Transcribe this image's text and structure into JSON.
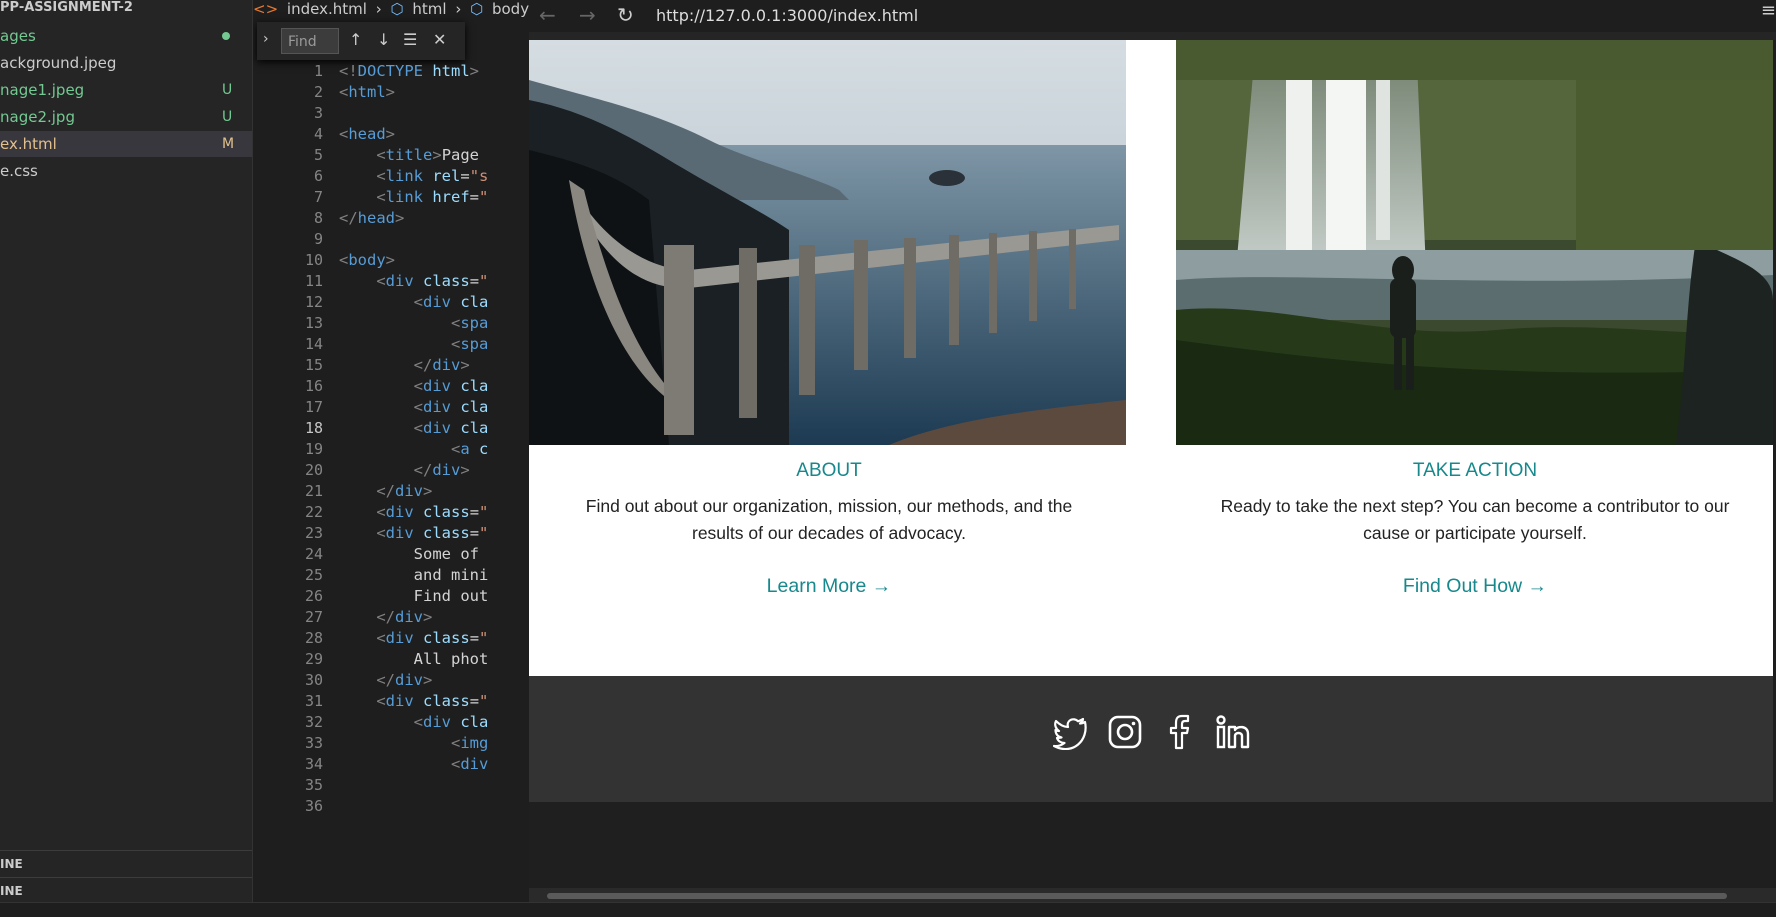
{
  "explorer": {
    "title": "PP-ASSIGNMENT-2",
    "items": [
      {
        "label": "ages",
        "badge": "",
        "status": "dot"
      },
      {
        "label": "ackground.jpeg",
        "badge": "",
        "status": "none"
      },
      {
        "label": "nage1.jpeg",
        "badge": "U",
        "status": "untracked"
      },
      {
        "label": "nage2.jpg",
        "badge": "U",
        "status": "untracked"
      },
      {
        "label": "ex.html",
        "badge": "M",
        "status": "modified"
      },
      {
        "label": "e.css",
        "badge": "",
        "status": "none"
      }
    ],
    "sections": [
      "INE",
      "INE"
    ]
  },
  "editor": {
    "breadcrumb": [
      "index.html",
      "html",
      "body"
    ],
    "find_placeholder": "Find",
    "current_line": 18,
    "line_numbers": [
      "1",
      "2",
      "3",
      "4",
      "5",
      "6",
      "7",
      "8",
      "9",
      "10",
      "11",
      "12",
      "13",
      "14",
      "15",
      "16",
      "17",
      "18",
      "19",
      "20",
      "21",
      "22",
      "23",
      "24",
      "25",
      "26",
      "27",
      "28",
      "29",
      "30",
      "31",
      "32",
      "33",
      "34",
      "35",
      "36"
    ]
  },
  "browser": {
    "url": "http://127.0.0.1:3000/index.html",
    "columns": [
      {
        "title": "ABOUT",
        "text": "Find out about our organization, mission, our methods, and the results of our decades of advocacy.",
        "link": "Learn More →"
      },
      {
        "title": "TAKE ACTION",
        "text": "Ready to take the next step? You can become a contributor to our cause or participate yourself.",
        "link": "Find Out How →"
      }
    ],
    "social_icons": [
      "twitter-icon",
      "instagram-icon",
      "facebook-icon",
      "linkedin-icon"
    ]
  },
  "colors": {
    "accent": "#17888c",
    "footer": "#333333",
    "editor_bg": "#1e1e1e",
    "sidebar_bg": "#252526"
  }
}
